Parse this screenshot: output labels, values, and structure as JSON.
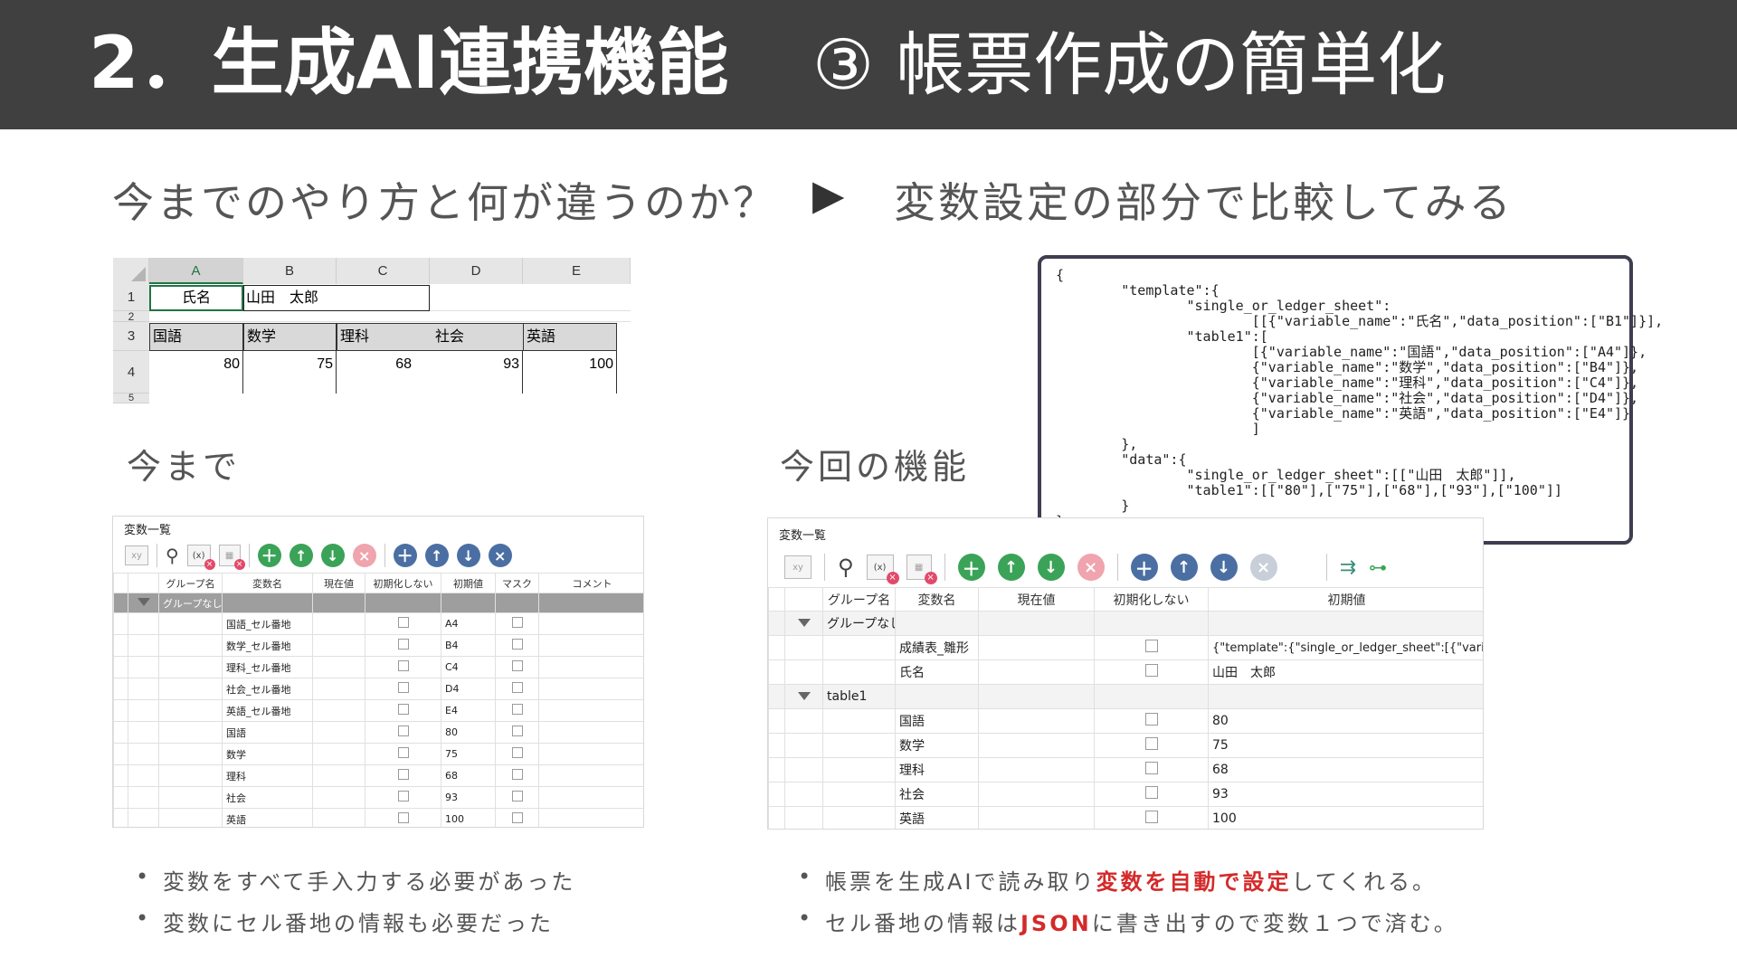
{
  "header": {
    "title": "2．生成AI連携機能",
    "subtitle": "③ 帳票作成の簡単化"
  },
  "subheading": {
    "left": "今までのやり方と何が違うのか？",
    "arrow": "▶",
    "right": "変数設定の部分で比較してみる"
  },
  "sheet": {
    "columns": [
      "A",
      "B",
      "C",
      "D",
      "E"
    ],
    "rows": [
      "1",
      "2",
      "3",
      "4",
      "5"
    ],
    "r1": {
      "label": "氏名",
      "value": "山田　太郎"
    },
    "r3": [
      "国語",
      "数学",
      "理科",
      "社会",
      "英語"
    ],
    "r4": [
      "80",
      "75",
      "68",
      "93",
      "100"
    ]
  },
  "json_popup": {
    "code": "{\n        \"template\":{\n                \"single_or_ledger_sheet\":\n                        [[{\"variable_name\":\"氏名\",\"data_position\":[\"B1\"]}],\n                \"table1\":[\n                        [{\"variable_name\":\"国語\",\"data_position\":[\"A4\"]},\n                        {\"variable_name\":\"数学\",\"data_position\":[\"B4\"]},\n                        {\"variable_name\":\"理科\",\"data_position\":[\"C4\"]},\n                        {\"variable_name\":\"社会\",\"data_position\":[\"D4\"]},\n                        {\"variable_name\":\"英語\",\"data_position\":[\"E4\"]}\n                        ]\n        },\n        \"data\":{\n                \"single_or_ledger_sheet\":[[\"山田　太郎\"]],\n                \"table1\":[[\"80\"],[\"75\"],[\"68\"],[\"93\"],[\"100\"]]\n        }\n}"
  },
  "left_section": {
    "label": "今まで",
    "panel_title": "変数一覧",
    "headers": [
      "グループ名",
      "変数名",
      "現在値",
      "初期化しない",
      "初期値",
      "マスク",
      "コメント"
    ],
    "group": "グループなし",
    "rows": [
      {
        "name": "国語_セル番地",
        "init": "A4"
      },
      {
        "name": "数学_セル番地",
        "init": "B4"
      },
      {
        "name": "理科_セル番地",
        "init": "C4"
      },
      {
        "name": "社会_セル番地",
        "init": "D4"
      },
      {
        "name": "英語_セル番地",
        "init": "E4"
      },
      {
        "name": "国語",
        "init": "80"
      },
      {
        "name": "数学",
        "init": "75"
      },
      {
        "name": "理科",
        "init": "68"
      },
      {
        "name": "社会",
        "init": "93"
      },
      {
        "name": "英語",
        "init": "100"
      }
    ],
    "bullets": [
      "変数をすべて手入力する必要があった",
      "変数にセル番地の情報も必要だった"
    ]
  },
  "right_section": {
    "label": "今回の機能",
    "panel_title": "変数一覧",
    "headers": [
      "グループ名",
      "変数名",
      "現在値",
      "初期化しない",
      "初期値"
    ],
    "group1": "グループなし",
    "group1_rows": [
      {
        "name": "成績表_雛形",
        "init": "{\"template\":{\"single_or_ledger_sheet\":[{\"variab"
      },
      {
        "name": "氏名",
        "init": "山田　太郎"
      }
    ],
    "group2": "table1",
    "group2_rows": [
      {
        "name": "国語",
        "init": "80"
      },
      {
        "name": "数学",
        "init": "75"
      },
      {
        "name": "理科",
        "init": "68"
      },
      {
        "name": "社会",
        "init": "93"
      },
      {
        "name": "英語",
        "init": "100"
      }
    ],
    "bullet1_pre": "帳票を生成AIで読み取り",
    "bullet1_hl": "変数を自動で設定",
    "bullet1_post": "してくれる。",
    "bullet2_pre": "セル番地の情報は",
    "bullet2_hl": "JSON",
    "bullet2_post": "に書き出すので変数１つで済む。"
  },
  "icons": {
    "add": "＋",
    "up": "↑",
    "down": "↓",
    "remove": "×",
    "colors": {
      "green": "#3aa357",
      "pink": "#f0a4ad",
      "blue": "#4b6fa3",
      "accent": "#d42a2a"
    }
  }
}
